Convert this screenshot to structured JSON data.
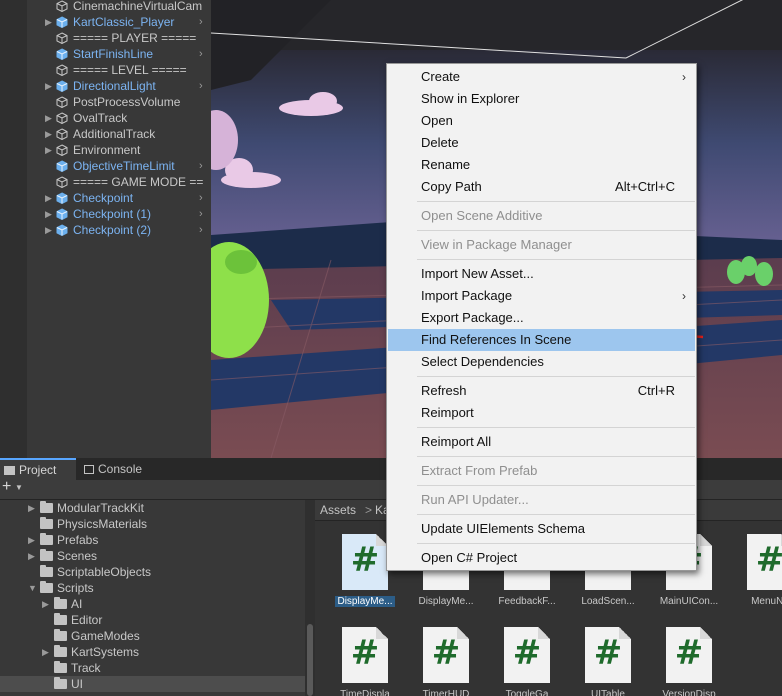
{
  "hierarchy": {
    "items": [
      {
        "label": "CinemachineVirtualCam",
        "prefab": false,
        "fold": false,
        "chevron": false
      },
      {
        "label": "KartClassic_Player",
        "prefab": true,
        "fold": true,
        "chevron": true
      },
      {
        "label": "===== PLAYER =====",
        "prefab": false,
        "fold": false,
        "chevron": false
      },
      {
        "label": "StartFinishLine",
        "prefab": true,
        "fold": false,
        "chevron": true
      },
      {
        "label": "===== LEVEL =====",
        "prefab": false,
        "fold": false,
        "chevron": false
      },
      {
        "label": "DirectionalLight",
        "prefab": true,
        "fold": true,
        "chevron": true
      },
      {
        "label": "PostProcessVolume",
        "prefab": false,
        "fold": false,
        "chevron": false
      },
      {
        "label": "OvalTrack",
        "prefab": false,
        "fold": true,
        "chevron": false
      },
      {
        "label": "AdditionalTrack",
        "prefab": false,
        "fold": true,
        "chevron": false
      },
      {
        "label": "Environment",
        "prefab": false,
        "fold": true,
        "chevron": false
      },
      {
        "label": "ObjectiveTimeLimit",
        "prefab": true,
        "fold": false,
        "chevron": true
      },
      {
        "label": "===== GAME MODE ==",
        "prefab": false,
        "fold": false,
        "chevron": false
      },
      {
        "label": "Checkpoint",
        "prefab": true,
        "fold": true,
        "chevron": true
      },
      {
        "label": "Checkpoint (1)",
        "prefab": true,
        "fold": true,
        "chevron": true
      },
      {
        "label": "Checkpoint (2)",
        "prefab": true,
        "fold": true,
        "chevron": true
      }
    ]
  },
  "tabs": {
    "project": "Project",
    "console": "Console"
  },
  "toolbar": {
    "add": "+"
  },
  "project_tree": [
    {
      "label": "ModularTrackKit",
      "fold": true,
      "open": false,
      "depth": 0,
      "selected": false
    },
    {
      "label": "PhysicsMaterials",
      "fold": false,
      "open": false,
      "depth": 0,
      "selected": false
    },
    {
      "label": "Prefabs",
      "fold": true,
      "open": false,
      "depth": 0,
      "selected": false
    },
    {
      "label": "Scenes",
      "fold": true,
      "open": false,
      "depth": 0,
      "selected": false
    },
    {
      "label": "ScriptableObjects",
      "fold": false,
      "open": false,
      "depth": 0,
      "selected": false
    },
    {
      "label": "Scripts",
      "fold": true,
      "open": true,
      "depth": 0,
      "selected": false
    },
    {
      "label": "AI",
      "fold": true,
      "open": false,
      "depth": 1,
      "selected": false
    },
    {
      "label": "Editor",
      "fold": false,
      "open": false,
      "depth": 1,
      "selected": false
    },
    {
      "label": "GameModes",
      "fold": false,
      "open": false,
      "depth": 1,
      "selected": false
    },
    {
      "label": "KartSystems",
      "fold": true,
      "open": false,
      "depth": 1,
      "selected": false
    },
    {
      "label": "Track",
      "fold": false,
      "open": false,
      "depth": 1,
      "selected": false
    },
    {
      "label": "UI",
      "fold": false,
      "open": false,
      "depth": 1,
      "selected": true
    }
  ],
  "breadcrumb": {
    "root": "Assets",
    "separator": ">",
    "next": "Ka"
  },
  "assets": [
    {
      "caption": "DisplayMe...",
      "selected": true
    },
    {
      "caption": "DisplayMe...",
      "selected": false
    },
    {
      "caption": "FeedbackF...",
      "selected": false
    },
    {
      "caption": "LoadScen...",
      "selected": false
    },
    {
      "caption": "MainUICon...",
      "selected": false
    },
    {
      "caption": "MenuNa",
      "selected": false
    },
    {
      "caption": "TimeDispla",
      "selected": false
    },
    {
      "caption": "TimerHUD",
      "selected": false
    },
    {
      "caption": "ToggleGa",
      "selected": false
    },
    {
      "caption": "UITable",
      "selected": false
    },
    {
      "caption": "VersionDisp",
      "selected": false
    }
  ],
  "context_menu": {
    "items": [
      {
        "label": "Create",
        "shortcut": "",
        "submenu": true,
        "disabled": false,
        "highlighted": false,
        "sep_after": false
      },
      {
        "label": "Show in Explorer",
        "shortcut": "",
        "submenu": false,
        "disabled": false,
        "highlighted": false,
        "sep_after": false
      },
      {
        "label": "Open",
        "shortcut": "",
        "submenu": false,
        "disabled": false,
        "highlighted": false,
        "sep_after": false
      },
      {
        "label": "Delete",
        "shortcut": "",
        "submenu": false,
        "disabled": false,
        "highlighted": false,
        "sep_after": false
      },
      {
        "label": "Rename",
        "shortcut": "",
        "submenu": false,
        "disabled": false,
        "highlighted": false,
        "sep_after": false
      },
      {
        "label": "Copy Path",
        "shortcut": "Alt+Ctrl+C",
        "submenu": false,
        "disabled": false,
        "highlighted": false,
        "sep_after": true
      },
      {
        "label": "Open Scene Additive",
        "shortcut": "",
        "submenu": false,
        "disabled": true,
        "highlighted": false,
        "sep_after": true
      },
      {
        "label": "View in Package Manager",
        "shortcut": "",
        "submenu": false,
        "disabled": true,
        "highlighted": false,
        "sep_after": true
      },
      {
        "label": "Import New Asset...",
        "shortcut": "",
        "submenu": false,
        "disabled": false,
        "highlighted": false,
        "sep_after": false
      },
      {
        "label": "Import Package",
        "shortcut": "",
        "submenu": true,
        "disabled": false,
        "highlighted": false,
        "sep_after": false
      },
      {
        "label": "Export Package...",
        "shortcut": "",
        "submenu": false,
        "disabled": false,
        "highlighted": false,
        "sep_after": false
      },
      {
        "label": "Find References In Scene",
        "shortcut": "",
        "submenu": false,
        "disabled": false,
        "highlighted": true,
        "sep_after": false
      },
      {
        "label": "Select Dependencies",
        "shortcut": "",
        "submenu": false,
        "disabled": false,
        "highlighted": false,
        "sep_after": true
      },
      {
        "label": "Refresh",
        "shortcut": "Ctrl+R",
        "submenu": false,
        "disabled": false,
        "highlighted": false,
        "sep_after": false
      },
      {
        "label": "Reimport",
        "shortcut": "",
        "submenu": false,
        "disabled": false,
        "highlighted": false,
        "sep_after": true
      },
      {
        "label": "Reimport All",
        "shortcut": "",
        "submenu": false,
        "disabled": false,
        "highlighted": false,
        "sep_after": true
      },
      {
        "label": "Extract From Prefab",
        "shortcut": "",
        "submenu": false,
        "disabled": true,
        "highlighted": false,
        "sep_after": true
      },
      {
        "label": "Run API Updater...",
        "shortcut": "",
        "submenu": false,
        "disabled": true,
        "highlighted": false,
        "sep_after": true
      },
      {
        "label": "Update UIElements Schema",
        "shortcut": "",
        "submenu": false,
        "disabled": false,
        "highlighted": false,
        "sep_after": true
      },
      {
        "label": "Open C# Project",
        "shortcut": "",
        "submenu": false,
        "disabled": false,
        "highlighted": false,
        "sep_after": false
      }
    ]
  },
  "icons": {
    "gameobject": "cube-outline-icon",
    "prefab": "cube-prefab-icon",
    "folder": "folder-icon",
    "script": "csharp-script-icon",
    "annotation": "red-arrow-icon"
  },
  "colors": {
    "prefab_text": "#7cb4f2",
    "menu_highlight": "#9dc6ee",
    "annotation_arrow": "#e8201b",
    "script_hash": "#1f6b2c"
  }
}
